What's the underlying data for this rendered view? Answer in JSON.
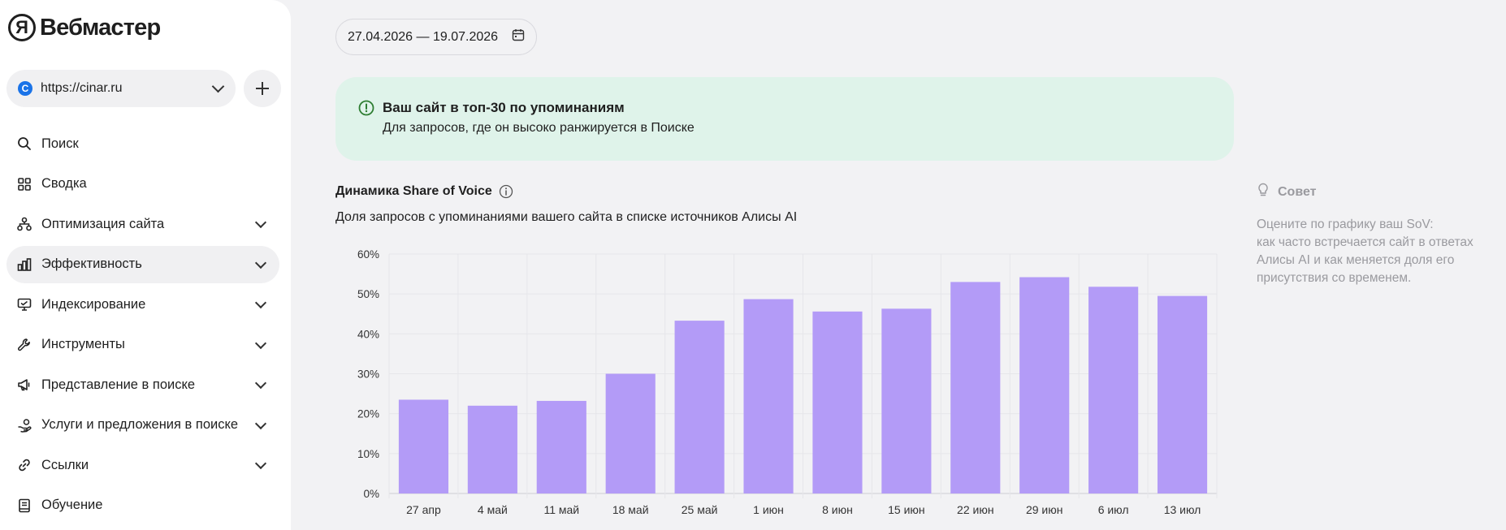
{
  "app": {
    "logo_letter": "Я",
    "logo_text": "Вебмастер"
  },
  "site": {
    "favicon_letter": "C",
    "url": "https://cinar.ru"
  },
  "nav": [
    {
      "label": "Поиск",
      "icon": "search-icon",
      "chevron": false,
      "active": false
    },
    {
      "label": "Сводка",
      "icon": "grid-icon",
      "chevron": false,
      "active": false
    },
    {
      "label": "Оптимизация сайта",
      "icon": "sitemap-icon",
      "chevron": true,
      "active": false
    },
    {
      "label": "Эффективность",
      "icon": "bar-chart-icon",
      "chevron": true,
      "active": true
    },
    {
      "label": "Индексирование",
      "icon": "monitor-icon",
      "chevron": true,
      "active": false
    },
    {
      "label": "Инструменты",
      "icon": "wrench-icon",
      "chevron": true,
      "active": false
    },
    {
      "label": "Представление в поиске",
      "icon": "megaphone-icon",
      "chevron": true,
      "active": false
    },
    {
      "label": "Услуги и предложения в поиске",
      "icon": "hand-coins-icon",
      "chevron": true,
      "active": false
    },
    {
      "label": "Ссылки",
      "icon": "link-icon",
      "chevron": true,
      "active": false
    },
    {
      "label": "Обучение",
      "icon": "book-icon",
      "chevron": false,
      "active": false
    }
  ],
  "date_range": "27.04.2026 — 19.07.2026",
  "banner": {
    "title": "Ваш сайт в топ-30 по упоминаниям",
    "subtitle": "Для запросов, где он высоко ранжируется в Поиске"
  },
  "chart_section": {
    "title": "Динамика Share of Voice",
    "subtitle": "Доля запросов с упоминаниями вашего сайта в списке источников Алисы AI"
  },
  "tip": {
    "label": "Совет",
    "text": "Оцените по графику ваш SoV:\nкак часто встречается сайт в ответах Алисы AI и как меняется доля его присутствия со временем."
  },
  "colors": {
    "bar": "#b39bf7",
    "banner_bg": "#dff3ea",
    "banner_icon": "#2e7d32"
  },
  "chart_data": {
    "type": "bar",
    "title": "",
    "xlabel": "",
    "ylabel": "",
    "categories": [
      "27 апр",
      "4 май",
      "11 май",
      "18 май",
      "25 май",
      "1 июн",
      "8 июн",
      "15 июн",
      "22 июн",
      "29 июн",
      "6 июл",
      "13 июл"
    ],
    "values": [
      23.5,
      22,
      23.2,
      30,
      43.3,
      48.7,
      45.6,
      46.3,
      53,
      54.2,
      51.8,
      49.5
    ],
    "ylim": [
      0,
      60
    ],
    "yticks": [
      "0%",
      "10%",
      "20%",
      "30%",
      "40%",
      "50%",
      "60%"
    ],
    "grid": true,
    "legend": "none"
  }
}
